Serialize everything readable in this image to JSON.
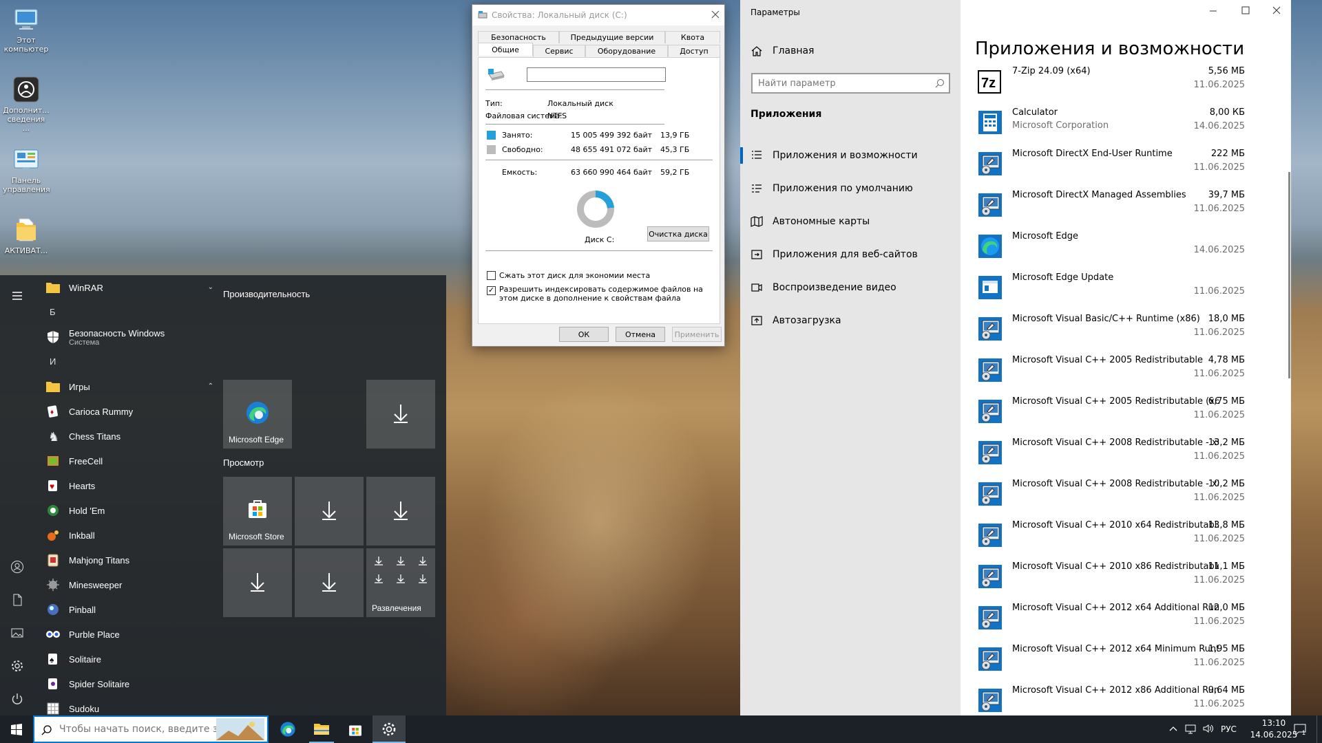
{
  "desktop": {
    "icons": [
      {
        "label": "Этот компьютер",
        "icon": "computer-icon"
      },
      {
        "label": "Дополнит... сведения ...",
        "icon": "info-icon"
      },
      {
        "label": "Панель управления",
        "icon": "control-panel-icon"
      },
      {
        "label": "АКТИВАТ...",
        "icon": "folder-icon"
      }
    ]
  },
  "start": {
    "apps": [
      {
        "type": "folder",
        "label": "WinRAR",
        "expand": "chevron-down"
      },
      {
        "type": "letter",
        "label": "Б"
      },
      {
        "type": "app",
        "label": "Безопасность Windows",
        "sub": "Система",
        "icon": "shield-icon"
      },
      {
        "type": "letter",
        "label": "И"
      },
      {
        "type": "folder",
        "label": "Игры",
        "expand": "chevron-up"
      },
      {
        "type": "app",
        "label": "Carioca Rummy",
        "icon": "cards-icon"
      },
      {
        "type": "app",
        "label": "Chess Titans",
        "icon": "chess-icon"
      },
      {
        "type": "app",
        "label": "FreeCell",
        "icon": "freecell-icon"
      },
      {
        "type": "app",
        "label": "Hearts",
        "icon": "hearts-icon"
      },
      {
        "type": "app",
        "label": "Hold 'Em",
        "icon": "poker-icon"
      },
      {
        "type": "app",
        "label": "Inkball",
        "icon": "inkball-icon"
      },
      {
        "type": "app",
        "label": "Mahjong Titans",
        "icon": "mahjong-icon"
      },
      {
        "type": "app",
        "label": "Minesweeper",
        "icon": "mine-icon"
      },
      {
        "type": "app",
        "label": "Pinball",
        "icon": "pinball-icon"
      },
      {
        "type": "app",
        "label": "Purble Place",
        "icon": "purble-icon"
      },
      {
        "type": "app",
        "label": "Solitaire",
        "icon": "solitaire-icon"
      },
      {
        "type": "app",
        "label": "Spider Solitaire",
        "icon": "spider-icon"
      },
      {
        "type": "app",
        "label": "Sudoku",
        "icon": "sudoku-icon"
      }
    ],
    "groups": {
      "performance": "Производительность",
      "browse": "Просмотр"
    },
    "tiles": {
      "edge": "Microsoft Edge",
      "store": "Microsoft Store",
      "entertainment": "Развлечения"
    }
  },
  "props": {
    "title": "Свойства: Локальный диск (C:)",
    "tabs_row1": [
      "Безопасность",
      "Предыдущие версии",
      "Квота"
    ],
    "tabs_row2": [
      "Общие",
      "Сервис",
      "Оборудование",
      "Доступ"
    ],
    "name_value": "",
    "type_label": "Тип:",
    "type_value": "Локальный диск",
    "fs_label": "Файловая система:",
    "fs_value": "NTFS",
    "used_label": "Занято:",
    "used_bytes": "15 005 499 392 байт",
    "used_gb": "13,9 ГБ",
    "free_label": "Свободно:",
    "free_bytes": "48 655 491 072 байт",
    "free_gb": "45,3 ГБ",
    "cap_label": "Емкость:",
    "cap_bytes": "63 660 990 464 байт",
    "cap_gb": "59,2 ГБ",
    "used_fraction": 0.236,
    "used_color": "#26a0da",
    "free_color": "#bcbcbc",
    "disk_label": "Диск C:",
    "cleanup": "Очистка диска",
    "compress": "Сжать этот диск для экономии места",
    "compress_checked": false,
    "index": "Разрешить индексировать содержимое файлов на этом диске в дополнение к свойствам файла",
    "index_checked": true,
    "ok": "ОК",
    "cancel": "Отмена",
    "apply": "Применить"
  },
  "settings": {
    "window_title": "Параметры",
    "home": "Главная",
    "search_placeholder": "Найти параметр",
    "section": "Приложения",
    "nav": [
      {
        "label": "Приложения и возможности",
        "icon": "apps-features-icon",
        "active": true
      },
      {
        "label": "Приложения по умолчанию",
        "icon": "default-apps-icon"
      },
      {
        "label": "Автономные карты",
        "icon": "offline-maps-icon"
      },
      {
        "label": "Приложения для веб-сайтов",
        "icon": "apps-websites-icon"
      },
      {
        "label": "Воспроизведение видео",
        "icon": "video-playback-icon"
      },
      {
        "label": "Автозагрузка",
        "icon": "startup-icon"
      }
    ],
    "heading": "Приложения и возможности",
    "apps": [
      {
        "name": "7-Zip 24.09 (x64)",
        "publisher": "",
        "size": "5,56 МБ",
        "date": "11.06.2025",
        "icon": "7zip-icon"
      },
      {
        "name": "Calculator",
        "publisher": "Microsoft Corporation",
        "size": "8,00 КБ",
        "date": "14.06.2025",
        "icon": "calculator-icon"
      },
      {
        "name": "Microsoft DirectX End-User Runtime",
        "publisher": "",
        "size": "222 МБ",
        "date": "11.06.2025",
        "icon": "installer-icon"
      },
      {
        "name": "Microsoft DirectX Managed Assemblies",
        "publisher": "",
        "size": "39,7 МБ",
        "date": "11.06.2025",
        "icon": "installer-icon"
      },
      {
        "name": "Microsoft Edge",
        "publisher": "",
        "size": "",
        "date": "14.06.2025",
        "icon": "edge-icon"
      },
      {
        "name": "Microsoft Edge Update",
        "publisher": "",
        "size": "",
        "date": "11.06.2025",
        "icon": "window-icon"
      },
      {
        "name": "Microsoft Visual Basic/C++ Runtime (x86)",
        "publisher": "",
        "size": "18,0 МБ",
        "date": "11.06.2025",
        "icon": "installer-icon"
      },
      {
        "name": "Microsoft Visual C++ 2005 Redistributable",
        "publisher": "",
        "size": "4,78 МБ",
        "date": "11.06.2025",
        "icon": "installer-icon"
      },
      {
        "name": "Microsoft Visual C++ 2005 Redistributable (x64)",
        "publisher": "",
        "size": "6,75 МБ",
        "date": "11.06.2025",
        "icon": "installer-icon"
      },
      {
        "name": "Microsoft Visual C++ 2008 Redistributable - x6...",
        "publisher": "",
        "size": "13,2 МБ",
        "date": "11.06.2025",
        "icon": "installer-icon"
      },
      {
        "name": "Microsoft Visual C++ 2008 Redistributable - x8...",
        "publisher": "",
        "size": "10,2 МБ",
        "date": "11.06.2025",
        "icon": "installer-icon"
      },
      {
        "name": "Microsoft Visual C++ 2010  x64 Redistributabl...",
        "publisher": "",
        "size": "13,8 МБ",
        "date": "11.06.2025",
        "icon": "installer-icon"
      },
      {
        "name": "Microsoft Visual C++ 2010  x86 Redistributable...",
        "publisher": "",
        "size": "11,1 МБ",
        "date": "11.06.2025",
        "icon": "installer-icon"
      },
      {
        "name": "Microsoft Visual C++ 2012 x64 Additional Runt...",
        "publisher": "",
        "size": "12,0 МБ",
        "date": "11.06.2025",
        "icon": "installer-icon"
      },
      {
        "name": "Microsoft Visual C++ 2012 x64 Minimum Runti...",
        "publisher": "",
        "size": "1,95 МБ",
        "date": "11.06.2025",
        "icon": "installer-icon"
      },
      {
        "name": "Microsoft Visual C++ 2012 x86 Additional Runt...",
        "publisher": "",
        "size": "9,64 МБ",
        "date": "11.06.2025",
        "icon": "installer-icon"
      }
    ]
  },
  "taskbar": {
    "search_placeholder": "Чтобы начать поиск, введите з",
    "lang": "РУС",
    "time": "13:10",
    "date": "14.06.2025",
    "notif_count": "1"
  }
}
